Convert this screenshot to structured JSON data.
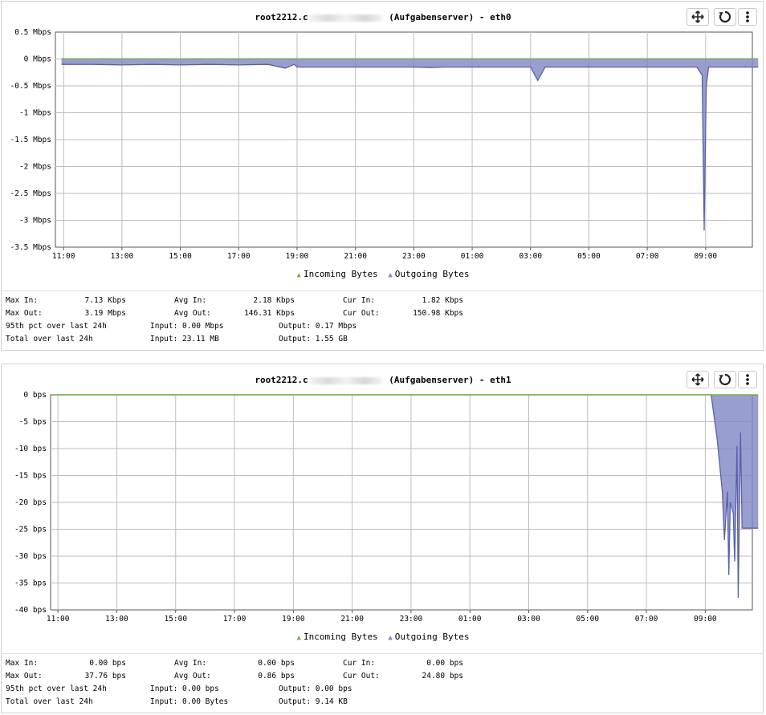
{
  "panels": [
    {
      "title_prefix": "root2212.c",
      "title_suffix": " (Aufgabenserver) - eth0",
      "legend": {
        "incoming": "Incoming Bytes",
        "outgoing": "Outgoing Bytes"
      },
      "stats": {
        "max_in_label": "Max In:",
        "max_in": "7.13 Kbps",
        "max_out_label": "Max Out:",
        "max_out": "3.19 Mbps",
        "avg_in_label": "Avg In:",
        "avg_in": "2.18 Kbps",
        "avg_out_label": "Avg Out:",
        "avg_out": "146.31 Kbps",
        "cur_in_label": "Cur In:",
        "cur_in": "1.82 Kbps",
        "cur_out_label": "Cur Out:",
        "cur_out": "150.98 Kbps",
        "pct_label": "95th pct over last 24h",
        "pct_input": "Input: 0.00 Mbps",
        "pct_output": "Output: 0.17 Mbps",
        "total_label": "Total over last 24h",
        "total_input": "Input: 23.11 MB",
        "total_output": "Output: 1.55 GB"
      }
    },
    {
      "title_prefix": "root2212.c",
      "title_suffix": " (Aufgabenserver) - eth1",
      "legend": {
        "incoming": "Incoming Bytes",
        "outgoing": "Outgoing Bytes"
      },
      "stats": {
        "max_in_label": "Max In:",
        "max_in": "0.00 bps",
        "max_out_label": "Max Out:",
        "max_out": "37.76 bps",
        "avg_in_label": "Avg In:",
        "avg_in": "0.00 bps",
        "avg_out_label": "Avg Out:",
        "avg_out": "0.86 bps",
        "cur_in_label": "Cur In:",
        "cur_in": "0.00 bps",
        "cur_out_label": "Cur Out:",
        "cur_out": "24.80 bps",
        "pct_label": "95th pct over last 24h",
        "pct_input": "Input: 0.00 bps",
        "pct_output": "Output: 0.00 bps",
        "total_label": "Total over last 24h",
        "total_input": "Input: 0.00 Bytes",
        "total_output": "Output: 9.14 KB"
      }
    }
  ],
  "colors": {
    "incoming": "#7bb04a",
    "outgoing": "#7f86c4",
    "outgoing_line": "#5a60a8",
    "grid": "#bdbdbd"
  },
  "chart_data": [
    {
      "type": "area",
      "title": "root2212.c… (Aufgabenserver) - eth0",
      "x_hours": [
        10.93,
        12,
        13,
        14,
        15,
        16,
        17,
        18,
        18.6,
        18.9,
        19,
        20,
        21,
        22,
        23,
        23.6,
        24,
        25,
        26,
        27,
        27.25,
        27.5,
        28,
        29,
        30,
        31,
        32,
        32.7,
        32.88,
        32.95,
        33.02,
        33.1,
        33.5,
        34.8
      ],
      "x_tick_labels": [
        "11:00",
        "13:00",
        "15:00",
        "17:00",
        "19:00",
        "21:00",
        "23:00",
        "01:00",
        "03:00",
        "05:00",
        "07:00",
        "09:00"
      ],
      "ylim": [
        -3.5,
        0.5
      ],
      "y_unit": "Mbps",
      "y_tick_labels": [
        "0.5 Mbps",
        "0 Mbps",
        "-0.5 Mbps",
        "-1 Mbps",
        "-1.5 Mbps",
        "-2 Mbps",
        "-2.5 Mbps",
        "-3 Mbps",
        "-3.5 Mbps"
      ],
      "series": [
        {
          "name": "Incoming Bytes",
          "values": [
            0.005,
            0.005,
            0.005,
            0.005,
            0.005,
            0.005,
            0.005,
            0.005,
            0.005,
            0.005,
            0.005,
            0.005,
            0.005,
            0.005,
            0.005,
            0.005,
            0.005,
            0.005,
            0.005,
            0.005,
            0.005,
            0.005,
            0.005,
            0.005,
            0.005,
            0.005,
            0.005,
            0.005,
            0.005,
            0.005,
            0.005,
            0.005,
            0.005,
            0.005
          ]
        },
        {
          "name": "Outgoing Bytes",
          "values": [
            -0.1,
            -0.1,
            -0.11,
            -0.1,
            -0.11,
            -0.1,
            -0.11,
            -0.1,
            -0.17,
            -0.1,
            -0.15,
            -0.15,
            -0.15,
            -0.15,
            -0.15,
            -0.16,
            -0.15,
            -0.15,
            -0.15,
            -0.15,
            -0.4,
            -0.15,
            -0.15,
            -0.15,
            -0.15,
            -0.15,
            -0.15,
            -0.15,
            -0.3,
            -3.19,
            -0.5,
            -0.15,
            -0.15,
            -0.15
          ]
        }
      ]
    },
    {
      "type": "area",
      "title": "root2212.c… (Aufgabenserver) - eth1",
      "x_hours": [
        10.93,
        33.2,
        33.4,
        33.58,
        33.65,
        33.75,
        33.8,
        33.85,
        33.95,
        34.0,
        34.08,
        34.12,
        34.2,
        34.25,
        34.3,
        34.33,
        34.8
      ],
      "x_tick_labels": [
        "11:00",
        "13:00",
        "15:00",
        "17:00",
        "19:00",
        "21:00",
        "23:00",
        "01:00",
        "03:00",
        "05:00",
        "07:00",
        "09:00"
      ],
      "ylim": [
        -40,
        0
      ],
      "y_unit": "bps",
      "y_tick_labels": [
        "0 bps",
        "-5 bps",
        "-10 bps",
        "-15 bps",
        "-20 bps",
        "-25 bps",
        "-30 bps",
        "-35 bps",
        "-40 bps"
      ],
      "series": [
        {
          "name": "Incoming Bytes",
          "values": [
            0,
            0,
            0,
            0,
            0,
            0,
            0,
            0,
            0,
            0,
            0,
            0,
            0,
            0,
            0,
            0,
            0
          ]
        },
        {
          "name": "Outgoing Bytes",
          "values": [
            0,
            0,
            -8,
            -18,
            -27,
            -18,
            -33.5,
            -20,
            -22,
            -31,
            -9.5,
            -37.76,
            -7,
            -24.8,
            -24.8,
            -24.8,
            -24.8
          ]
        }
      ]
    }
  ]
}
